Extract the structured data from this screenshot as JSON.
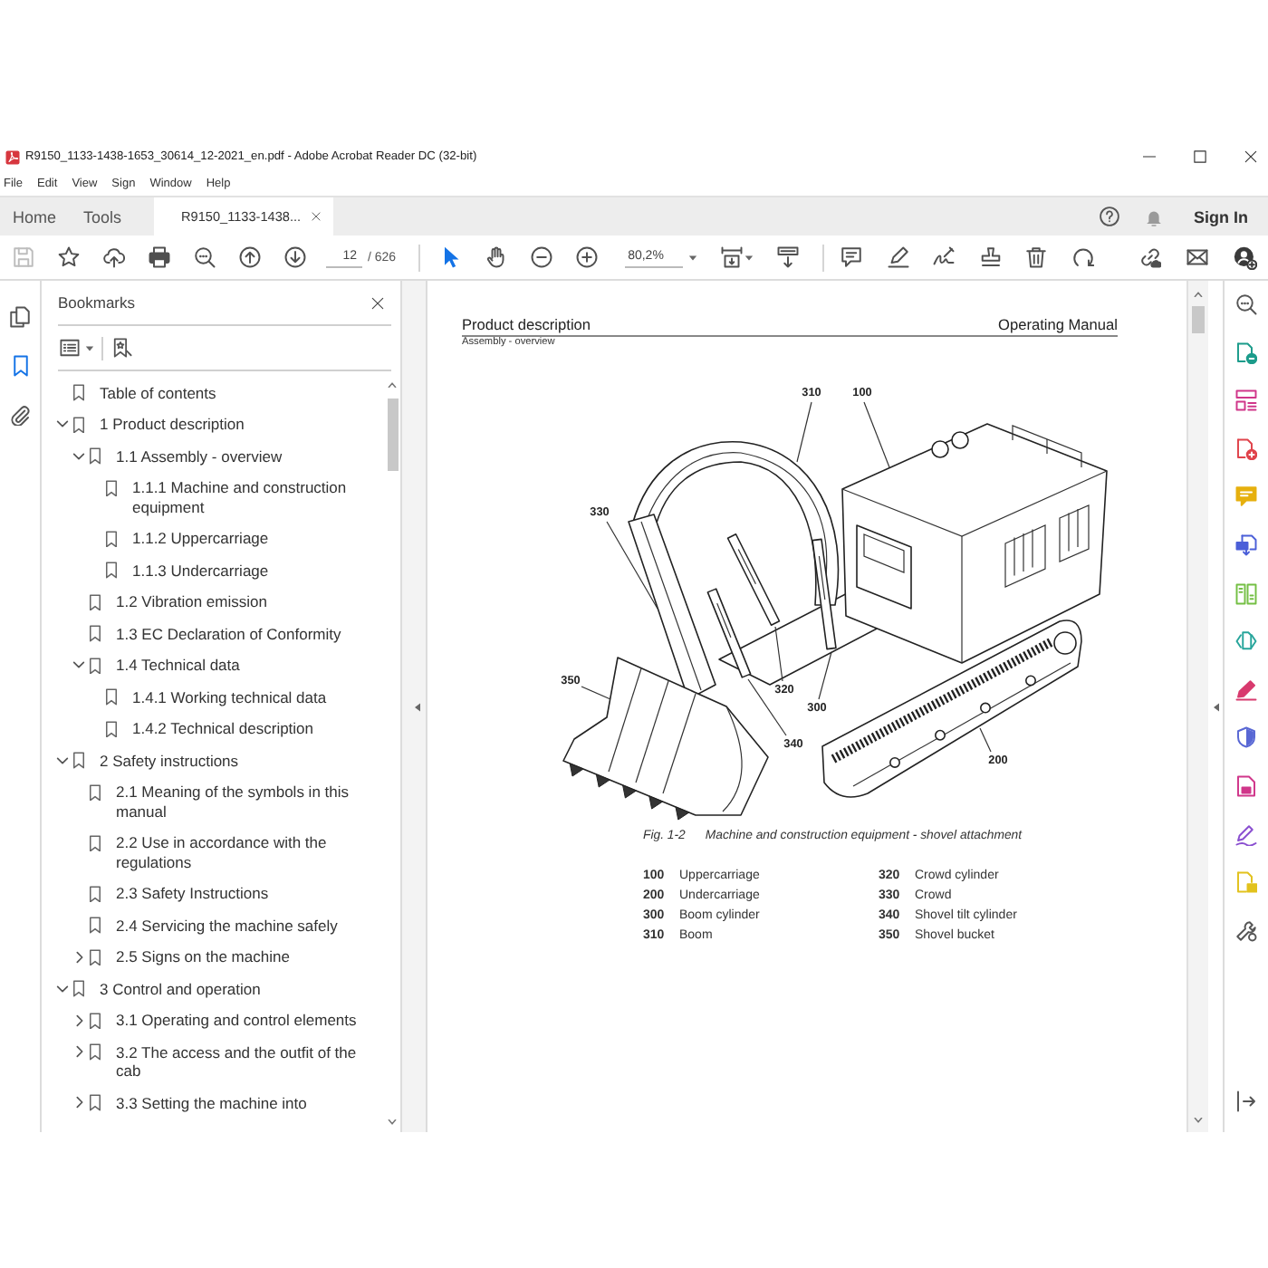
{
  "window": {
    "title": "R9150_1133-1438-1653_30614_12-2021_en.pdf - Adobe Acrobat Reader DC (32-bit)"
  },
  "menu_bar": [
    "File",
    "Edit",
    "View",
    "Sign",
    "Window",
    "Help"
  ],
  "tabs": [
    {
      "kind": "home",
      "label": "Home",
      "selected": false
    },
    {
      "kind": "tools",
      "label": "Tools",
      "selected": false
    },
    {
      "kind": "document",
      "label": "R9150_1133-1438...",
      "selected": true
    }
  ],
  "account": {
    "label": "Sign In"
  },
  "toolbar": {
    "file_tools": [
      {
        "kind": "save",
        "disabled": true
      },
      {
        "kind": "star",
        "disabled": false
      },
      {
        "kind": "upload",
        "disabled": false
      },
      {
        "kind": "print",
        "disabled": false
      },
      {
        "kind": "find",
        "disabled": false
      },
      {
        "kind": "previous-page",
        "disabled": false
      },
      {
        "kind": "next-page",
        "disabled": false
      }
    ],
    "page_field": {
      "value": "12",
      "total": "/ 626"
    },
    "pointer_tools": [
      {
        "kind": "select",
        "selected": true
      },
      {
        "kind": "hand",
        "selected": false
      }
    ],
    "zoom_field": {
      "value": "80,2%"
    }
  },
  "left_rail": [
    {
      "kind": "pages",
      "selected": false
    },
    {
      "kind": "bookmarks",
      "selected": true
    },
    {
      "kind": "attachments",
      "selected": false
    }
  ],
  "bookmarks_panel": {
    "title": "Bookmarks",
    "items": [
      {
        "label": "Table of contents"
      },
      {
        "label": "1 Product description",
        "expanded": true,
        "children": [
          {
            "label": "1.1 Assembly - overview",
            "expanded": true,
            "children": [
              {
                "label": "1.1.1 Machine and construction equipment"
              },
              {
                "label": "1.1.2 Uppercarriage"
              },
              {
                "label": "1.1.3 Undercarriage"
              }
            ]
          },
          {
            "label": "1.2 Vibration emission"
          },
          {
            "label": "1.3 EC Declaration of Conformity"
          },
          {
            "label": "1.4 Technical data",
            "expanded": true,
            "children": [
              {
                "label": "1.4.1 Working technical data"
              },
              {
                "label": "1.4.2 Technical description"
              }
            ]
          }
        ]
      },
      {
        "label": "2 Safety instructions",
        "expanded": true,
        "children": [
          {
            "label": "2.1 Meaning of the symbols in this manual"
          },
          {
            "label": "2.2 Use in accordance with the regulations"
          },
          {
            "label": "2.3 Safety Instructions"
          },
          {
            "label": "2.4 Servicing the machine safely"
          },
          {
            "label": "2.5 Signs on the machine",
            "expanded": false
          }
        ]
      },
      {
        "label": "3 Control and operation",
        "expanded": true,
        "children": [
          {
            "label": "3.1 Operating and control elements",
            "expanded": false
          },
          {
            "label": "3.2 The access and the outfit of the cab",
            "expanded": false
          },
          {
            "label": "3.3 Setting the machine into",
            "expanded": false
          }
        ]
      }
    ]
  },
  "document": {
    "header_left": "Product description",
    "header_right": "Operating Manual",
    "section": "Assembly - overview",
    "figure": {
      "callouts": [
        {
          "label": "310"
        },
        {
          "label": "100"
        },
        {
          "label": "330"
        },
        {
          "label": "350"
        },
        {
          "label": "320"
        },
        {
          "label": "300"
        },
        {
          "label": "340"
        },
        {
          "label": "200"
        }
      ],
      "caption_number": "Fig. 1-2",
      "caption_text": "Machine and construction equipment - shovel attachment"
    },
    "legend": [
      {
        "number": "100",
        "label": "Uppercarriage"
      },
      {
        "number": "200",
        "label": "Undercarriage"
      },
      {
        "number": "300",
        "label": "Boom cylinder"
      },
      {
        "number": "310",
        "label": "Boom"
      },
      {
        "number": "320",
        "label": "Crowd cylinder"
      },
      {
        "number": "330",
        "label": "Crowd"
      },
      {
        "number": "340",
        "label": "Shovel tilt cylinder"
      },
      {
        "number": "350",
        "label": "Shovel bucket"
      }
    ]
  }
}
